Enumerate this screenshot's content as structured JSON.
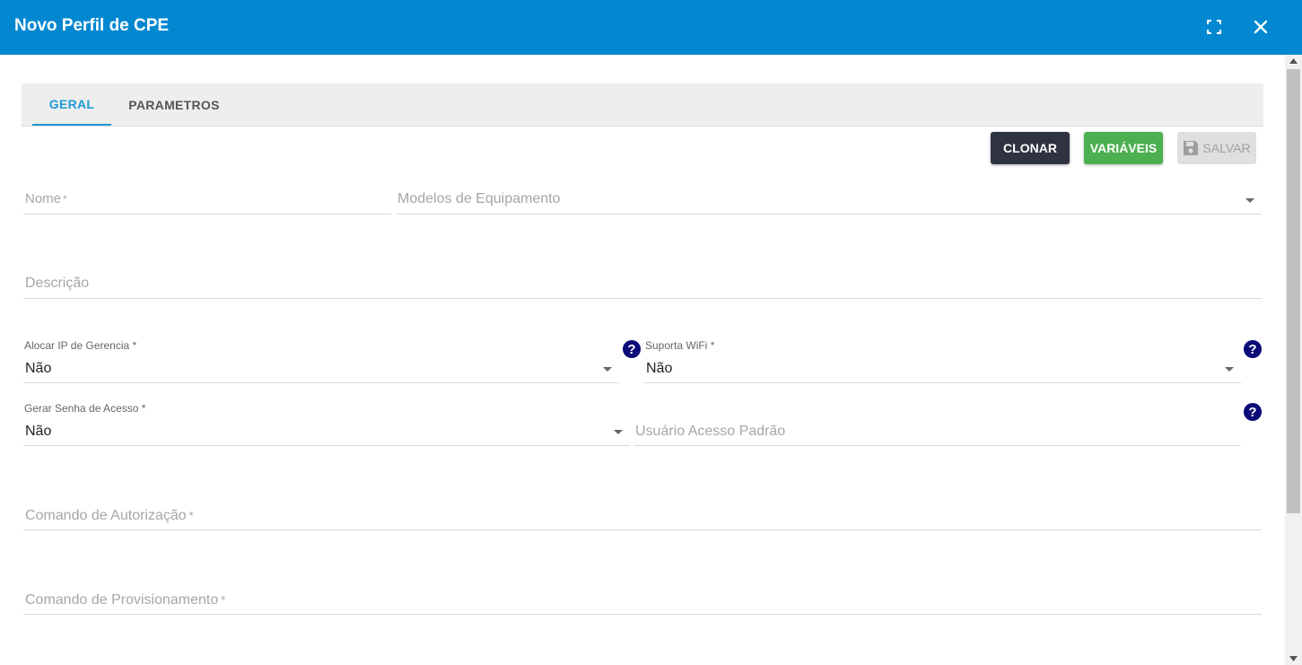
{
  "dialog": {
    "title": "Novo Perfil de CPE"
  },
  "tabs": [
    {
      "label": "GERAL",
      "active": true
    },
    {
      "label": "PARAMETROS",
      "active": false
    }
  ],
  "actions": {
    "clonar_label": "CLONAR",
    "variaveis_label": "VARIÁVEIS",
    "salvar_label": "SALVAR"
  },
  "form": {
    "nome": {
      "placeholder": "Nome",
      "required_mark": "*"
    },
    "modelos": {
      "placeholder": "Modelos de Equipamento"
    },
    "descricao": {
      "placeholder": "Descrição"
    },
    "alocar_ip": {
      "label": "Alocar IP de Gerencia",
      "required_mark": "*",
      "value": "Não"
    },
    "suporta_wifi": {
      "label": "Suporta WiFi",
      "required_mark": "*",
      "value": "Não"
    },
    "gerar_senha": {
      "label": "Gerar Senha de Acesso",
      "required_mark": "*",
      "value": "Não"
    },
    "usuario_acesso": {
      "placeholder": "Usuário Acesso Padrão"
    },
    "comando_autorizacao": {
      "placeholder": "Comando de Autorização",
      "required_mark": "*"
    },
    "comando_provisionamento": {
      "placeholder": "Comando de Provisionamento",
      "required_mark": "*"
    }
  },
  "help_icon_glyph": "?",
  "colors": {
    "header": "#0288d1",
    "tab_active": "#1e9ad6",
    "clonar": "#2e3241",
    "variaveis": "#4caf50",
    "help": "#0a0a78"
  }
}
